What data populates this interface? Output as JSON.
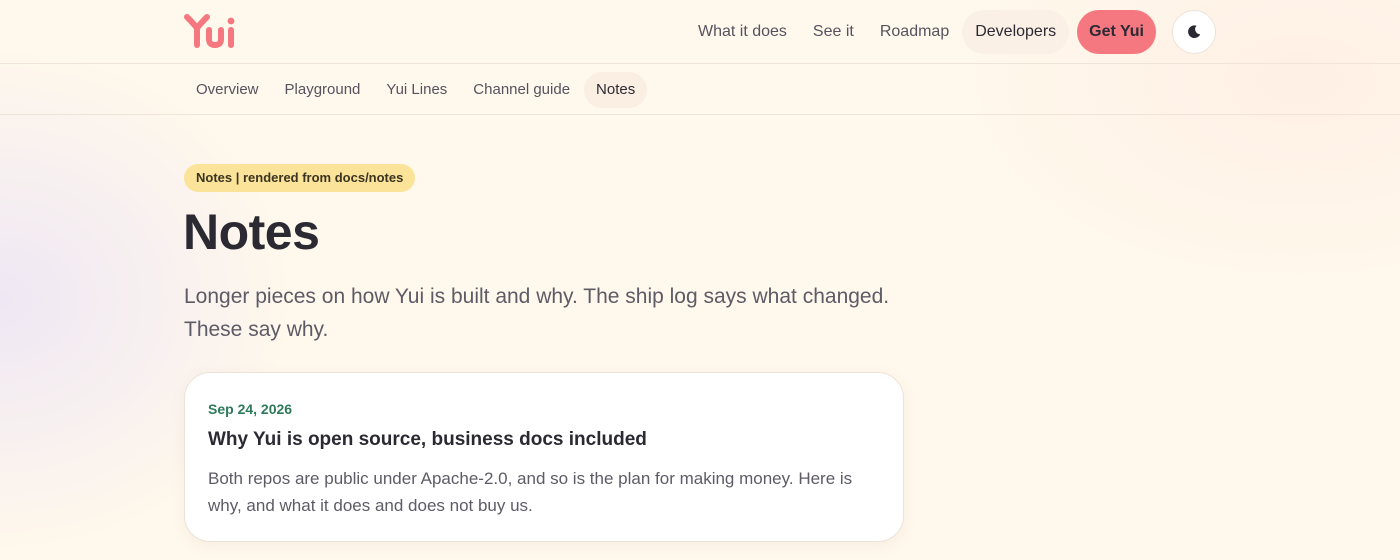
{
  "brand": {
    "logo_text": "Yui",
    "color": "#f57780"
  },
  "header": {
    "nav": [
      {
        "label": "What it does"
      },
      {
        "label": "See it"
      },
      {
        "label": "Roadmap"
      },
      {
        "label": "Developers"
      }
    ],
    "cta_label": "Get Yui",
    "theme_toggle_icon": "moon-icon"
  },
  "subnav": {
    "items": [
      {
        "label": "Overview"
      },
      {
        "label": "Playground"
      },
      {
        "label": "Yui Lines"
      },
      {
        "label": "Channel guide"
      },
      {
        "label": "Notes",
        "active": true
      }
    ]
  },
  "main": {
    "eyebrow": "Notes | rendered from docs/notes",
    "title": "Notes",
    "lede": "Longer pieces on how Yui is built and why. The ship log says what changed. These say why."
  },
  "notes": [
    {
      "date": "Sep 24, 2026",
      "title": "Why Yui is open source, business docs included",
      "summary": "Both repos are public under Apache-2.0, and so is the plan for making money. Here is why, and what it does and does not buy us."
    }
  ],
  "colors": {
    "accent": "#f57780",
    "eyebrow_bg": "#fbe39a",
    "date_green": "#2e7a5b",
    "background": "#fff8ec"
  }
}
